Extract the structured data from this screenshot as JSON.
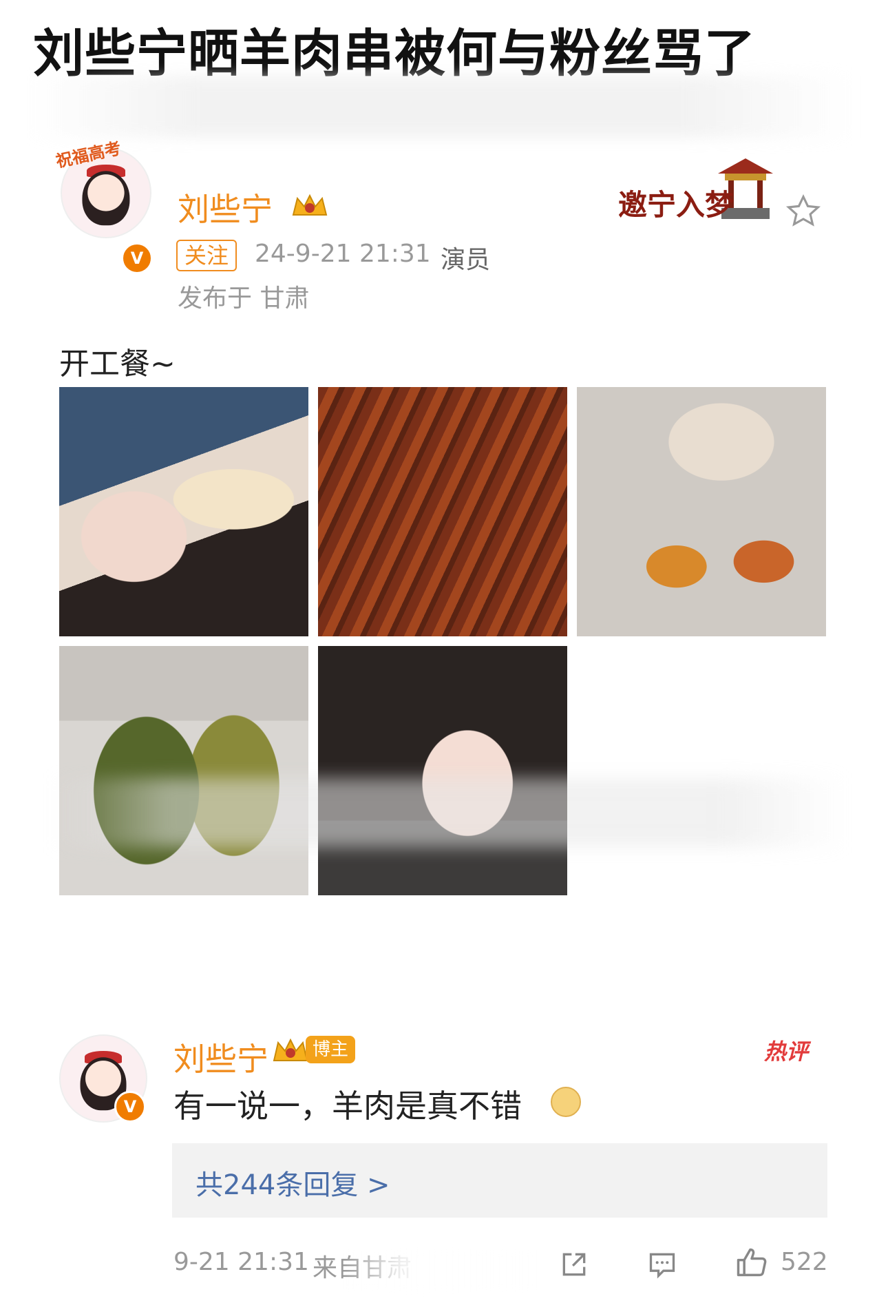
{
  "headline": "刘些宁晒羊肉串被何与粉丝骂了",
  "post": {
    "username": "刘些宁",
    "follow_label": "关注",
    "timestamp": "24-9-21 21:31",
    "role": "演员",
    "location": "发布于 甘肃",
    "text": "开工餐~",
    "avatar_badge_text": "祝福高考",
    "verified_mark": "V",
    "banner_text": "邀宁入梦",
    "photos": [
      {
        "name": "selfie-bread"
      },
      {
        "name": "lamb-skewers"
      },
      {
        "name": "hotpot-oysters"
      },
      {
        "name": "herbal-tea"
      },
      {
        "name": "selfie-car"
      }
    ]
  },
  "comment": {
    "username": "刘些宁",
    "blogger_badge": "博主",
    "hot_tag": "热评",
    "text": "有一说一，羊肉是真不错",
    "reply_link": "共244条回复 >",
    "timestamp": "9-21 21:31",
    "source": "来自甘肃",
    "like_count": "522"
  },
  "colors": {
    "accent_orange": "#f08c1e",
    "link_blue": "#4a6ea9",
    "hot_red": "#e23b3b",
    "meta_gray": "#999999"
  },
  "icons": [
    "star-icon",
    "crown-icon",
    "share-icon",
    "comment-icon",
    "like-icon",
    "doge-emoji-icon"
  ]
}
